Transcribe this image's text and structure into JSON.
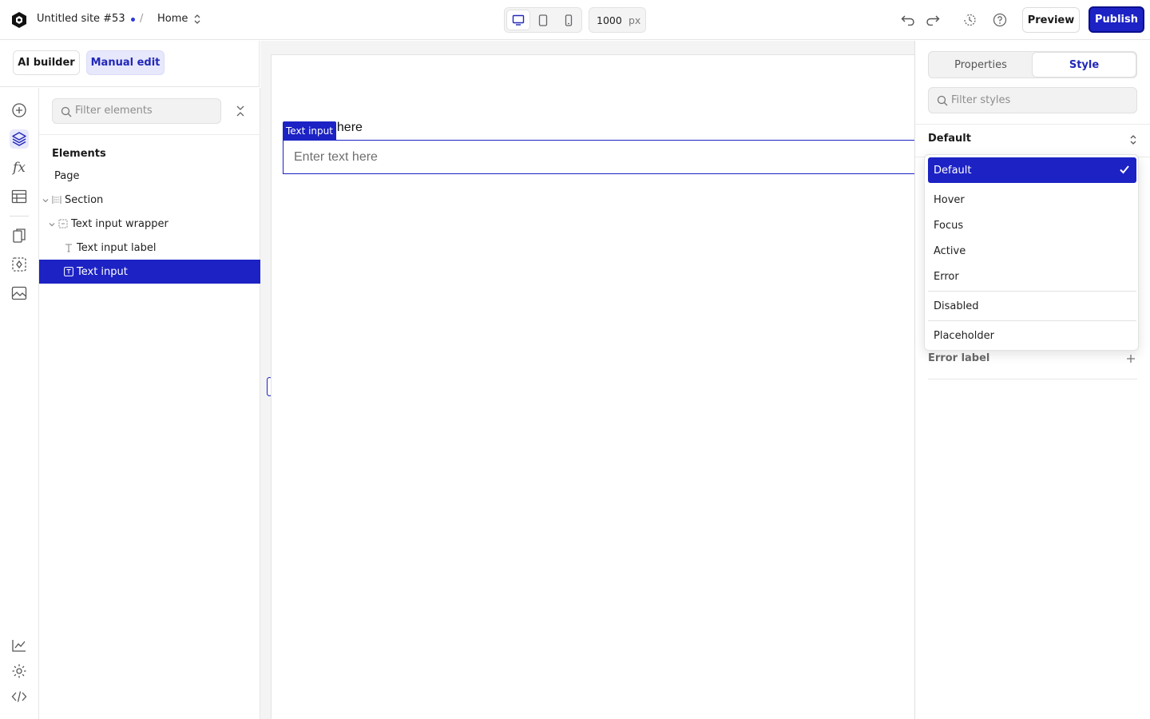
{
  "topbar": {
    "site_name": "Untitled site #53",
    "separator": "/",
    "page": "Home",
    "width_value": "1000",
    "width_unit": "px",
    "preview_label": "Preview",
    "publish_label": "Publish"
  },
  "modes": {
    "ai_builder": "AI builder",
    "manual_edit": "Manual edit"
  },
  "layers": {
    "filter_placeholder": "Filter elements",
    "title": "Elements",
    "tree": [
      {
        "label": "Page"
      },
      {
        "label": "Section"
      },
      {
        "label": "Text input wrapper"
      },
      {
        "label": "Text input label"
      },
      {
        "label": "Text input"
      }
    ]
  },
  "canvas": {
    "label_visible": "t here",
    "badge": "Text input",
    "input_placeholder": "Enter text here"
  },
  "style_panel": {
    "tab_properties": "Properties",
    "tab_style": "Style",
    "filter_placeholder": "Filter styles",
    "state_selected": "Default",
    "error_label": "Error label",
    "state_options": [
      "Default",
      "Hover",
      "Focus",
      "Active",
      "Error",
      "Disabled",
      "Placeholder"
    ]
  },
  "colors": {
    "accent": "#1c22c4",
    "accent_light": "#e7e8fb"
  }
}
